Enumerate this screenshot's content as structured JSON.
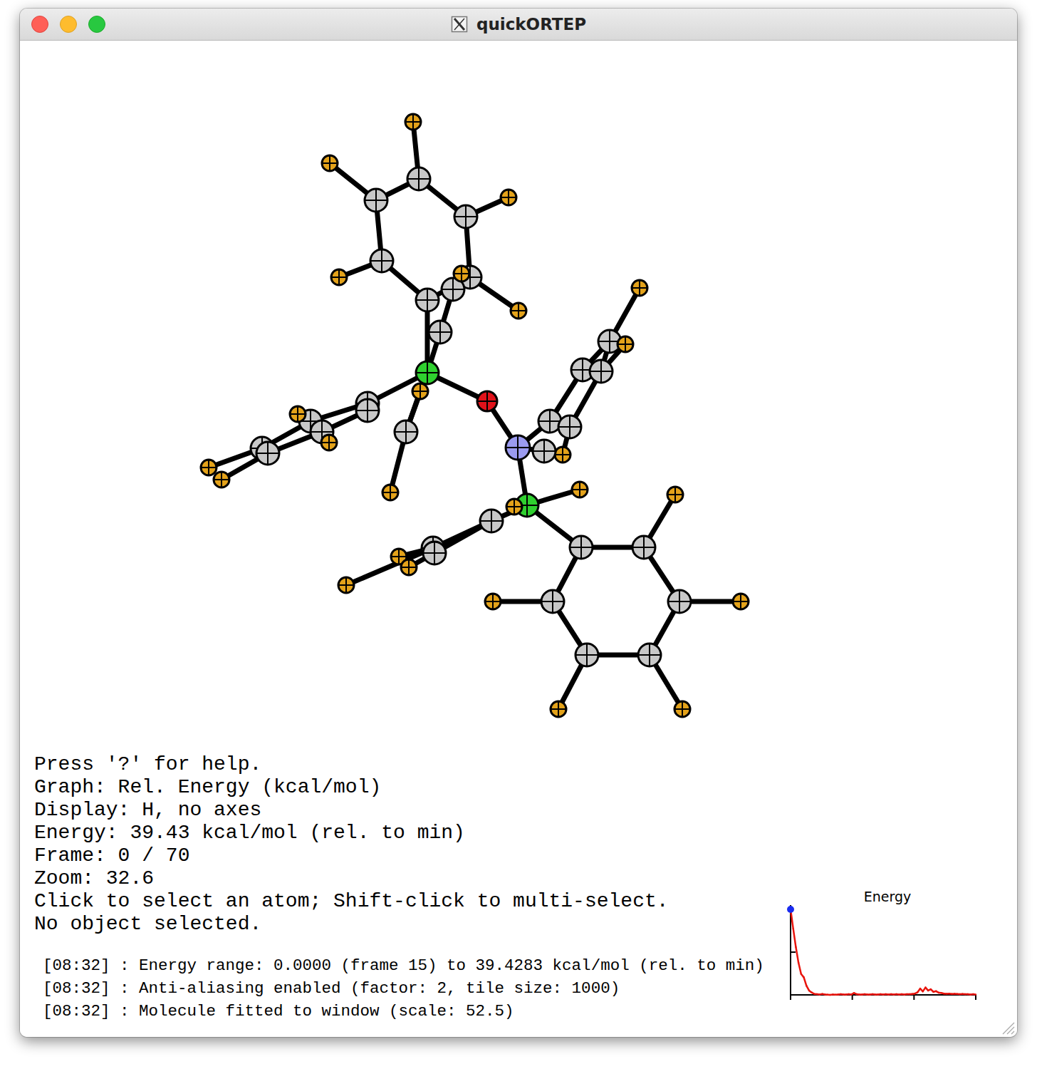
{
  "window": {
    "title": "quickORTEP"
  },
  "info_lines": [
    "Press '?' for help.",
    "Graph: Rel. Energy (kcal/mol)",
    "Display: H, no axes",
    "Energy: 39.43 kcal/mol (rel. to min)",
    "Frame: 0 / 70",
    "Zoom: 32.6",
    "Click to select an atom; Shift-click to multi-select.",
    "No object selected."
  ],
  "log_lines": [
    "[08:32] : Energy range: 0.0000 (frame 15) to 39.4283 kcal/mol (rel. to min)",
    "[08:32] : Anti-aliasing enabled (factor: 2, tile size: 1000)",
    "[08:32] : Molecule fitted to window (scale: 52.5)"
  ],
  "graph": {
    "title": "Energy",
    "current_frame": 0,
    "values": [
      39.43,
      30.5,
      22.0,
      14.8,
      9.6,
      8.1,
      4.2,
      2.0,
      1.1,
      0.4,
      0.3,
      0.2,
      0.4,
      0.2,
      0.1,
      0.0,
      0.2,
      0.1,
      0.2,
      0.3,
      0.2,
      0.2,
      0.3,
      0.2,
      0.9,
      0.3,
      0.2,
      0.2,
      0.3,
      0.2,
      0.2,
      0.3,
      0.2,
      0.2,
      0.3,
      0.2,
      0.3,
      0.2,
      0.3,
      0.2,
      0.3,
      0.2,
      0.3,
      0.2,
      0.3,
      0.3,
      0.4,
      0.6,
      1.2,
      2.9,
      1.6,
      3.4,
      2.0,
      2.6,
      1.4,
      1.7,
      1.0,
      0.9,
      0.6,
      0.5,
      0.6,
      0.4,
      0.5,
      0.4,
      0.3,
      0.4,
      0.3,
      0.3,
      0.2,
      0.3,
      0.2
    ]
  },
  "molecule": {
    "atoms": [
      {
        "element": "P",
        "color": "#2fd02f"
      },
      {
        "element": "O",
        "color": "#e0121a"
      },
      {
        "element": "N",
        "color": "#9b9bf0"
      },
      {
        "element": "P",
        "color": "#2fd02f"
      },
      {
        "element": "C",
        "color": "#c8c8c8"
      },
      {
        "element": "C",
        "color": "#c8c8c8"
      },
      {
        "element": "C",
        "color": "#c8c8c8"
      },
      {
        "element": "C",
        "color": "#c8c8c8"
      },
      {
        "element": "C",
        "color": "#c8c8c8"
      },
      {
        "element": "C",
        "color": "#c8c8c8"
      },
      {
        "element": "H",
        "color": "#e3a21a"
      },
      {
        "element": "H",
        "color": "#e3a21a"
      },
      {
        "element": "H",
        "color": "#e3a21a"
      },
      {
        "element": "H",
        "color": "#e3a21a"
      },
      {
        "element": "H",
        "color": "#e3a21a"
      },
      {
        "element": "C",
        "color": "#c8c8c8"
      },
      {
        "element": "C",
        "color": "#c8c8c8"
      },
      {
        "element": "H",
        "color": "#e3a21a"
      },
      {
        "element": "C",
        "color": "#c8c8c8"
      },
      {
        "element": "H",
        "color": "#e3a21a"
      },
      {
        "element": "H",
        "color": "#e3a21a"
      },
      {
        "element": "C",
        "color": "#c8c8c8"
      },
      {
        "element": "C",
        "color": "#c8c8c8"
      },
      {
        "element": "C",
        "color": "#c8c8c8"
      },
      {
        "element": "C",
        "color": "#c8c8c8"
      },
      {
        "element": "C",
        "color": "#c8c8c8"
      },
      {
        "element": "C",
        "color": "#c8c8c8"
      },
      {
        "element": "H",
        "color": "#e3a21a"
      },
      {
        "element": "H",
        "color": "#e3a21a"
      },
      {
        "element": "H",
        "color": "#e3a21a"
      },
      {
        "element": "H",
        "color": "#e3a21a"
      },
      {
        "element": "C",
        "color": "#c8c8c8"
      },
      {
        "element": "C",
        "color": "#c8c8c8"
      },
      {
        "element": "C",
        "color": "#c8c8c8"
      },
      {
        "element": "C",
        "color": "#c8c8c8"
      },
      {
        "element": "C",
        "color": "#c8c8c8"
      },
      {
        "element": "H",
        "color": "#e3a21a"
      },
      {
        "element": "H",
        "color": "#e3a21a"
      },
      {
        "element": "H",
        "color": "#e3a21a"
      },
      {
        "element": "C",
        "color": "#c8c8c8"
      },
      {
        "element": "C",
        "color": "#c8c8c8"
      },
      {
        "element": "C",
        "color": "#c8c8c8"
      },
      {
        "element": "C",
        "color": "#c8c8c8"
      },
      {
        "element": "C",
        "color": "#c8c8c8"
      },
      {
        "element": "C",
        "color": "#c8c8c8"
      },
      {
        "element": "C",
        "color": "#c8c8c8"
      },
      {
        "element": "H",
        "color": "#e3a21a"
      },
      {
        "element": "H",
        "color": "#e3a21a"
      },
      {
        "element": "H",
        "color": "#e3a21a"
      },
      {
        "element": "H",
        "color": "#e3a21a"
      },
      {
        "element": "H",
        "color": "#e3a21a"
      },
      {
        "element": "C",
        "color": "#c8c8c8"
      },
      {
        "element": "C",
        "color": "#c8c8c8"
      },
      {
        "element": "C",
        "color": "#c8c8c8"
      },
      {
        "element": "H",
        "color": "#e3a21a"
      },
      {
        "element": "H",
        "color": "#e3a21a"
      },
      {
        "element": "H",
        "color": "#e3a21a"
      },
      {
        "element": "H",
        "color": "#e3a21a"
      },
      {
        "element": "H",
        "color": "#e3a21a"
      }
    ]
  }
}
